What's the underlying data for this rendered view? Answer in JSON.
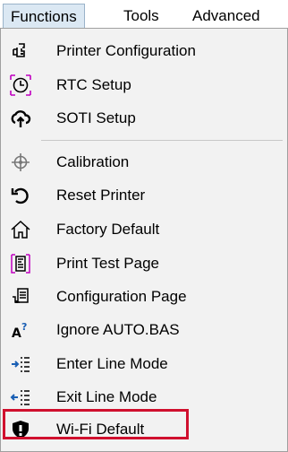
{
  "menubar": {
    "functions": "Functions",
    "tools": "Tools",
    "advanced": "Advanced"
  },
  "menu": {
    "items": [
      {
        "label": "Printer Configuration",
        "icon": "printer-config-icon"
      },
      {
        "label": "RTC Setup",
        "icon": "clock-icon"
      },
      {
        "label": "SOTI Setup",
        "icon": "cloud-upload-icon"
      },
      {
        "label": "Calibration",
        "icon": "crosshair-icon"
      },
      {
        "label": "Reset Printer",
        "icon": "reset-arrow-icon"
      },
      {
        "label": "Factory Default",
        "icon": "home-icon"
      },
      {
        "label": "Print Test Page",
        "icon": "test-page-icon"
      },
      {
        "label": "Configuration Page",
        "icon": "config-page-icon"
      },
      {
        "label": "Ignore AUTO.BAS",
        "icon": "ignore-autobas-icon"
      },
      {
        "label": "Enter Line Mode",
        "icon": "enter-line-mode-icon"
      },
      {
        "label": "Exit Line Mode",
        "icon": "exit-line-mode-icon"
      },
      {
        "label": "Wi-Fi Default",
        "icon": "shield-icon"
      }
    ]
  },
  "colors": {
    "highlight_border": "#d0102e",
    "active_menu_bg": "#dbe8f3",
    "icon_blue": "#1a5fb4",
    "icon_magenta": "#c000c0"
  }
}
